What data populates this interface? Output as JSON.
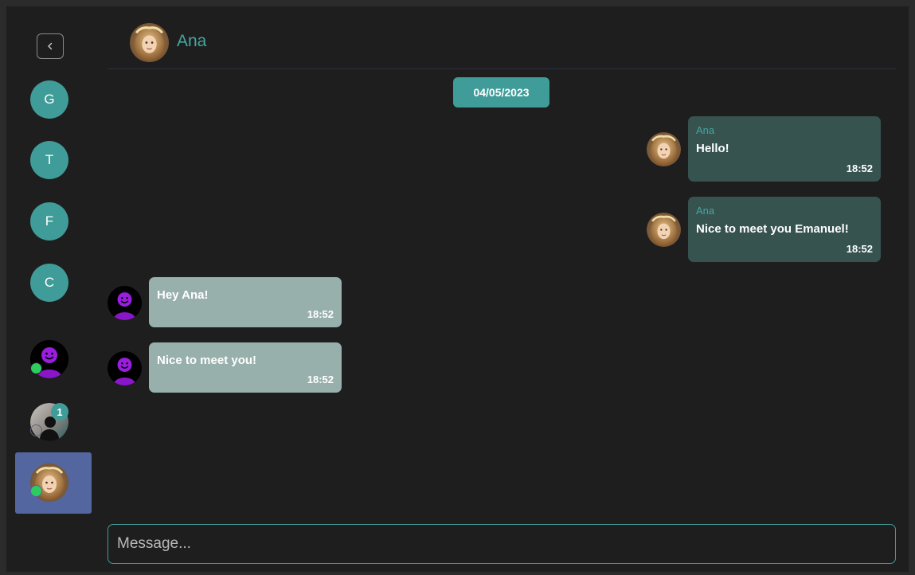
{
  "sidebar": {
    "back_icon": "chevron-left-icon",
    "contacts": [
      {
        "initial": "G"
      },
      {
        "initial": "T"
      },
      {
        "initial": "F"
      },
      {
        "initial": "C"
      }
    ],
    "unread_badge": "1"
  },
  "header": {
    "contact_name": "Ana"
  },
  "chat": {
    "date": "04/05/2023",
    "messages": [
      {
        "sender": "Ana",
        "text": "Hello!",
        "time": "18:52"
      },
      {
        "sender": "Ana",
        "text": "Nice to meet you Emanuel!",
        "time": "18:52"
      },
      {
        "text": "Hey Ana!",
        "time": "18:52"
      },
      {
        "text": "Nice to meet you!",
        "time": "18:52"
      }
    ]
  },
  "composer": {
    "placeholder": "Message..."
  },
  "colors": {
    "accent": "#3f9c98",
    "incoming_bubble": "#365350",
    "outgoing_bubble": "#98b0ac",
    "active_contact": "#5366a0",
    "online": "#2ecc60"
  }
}
